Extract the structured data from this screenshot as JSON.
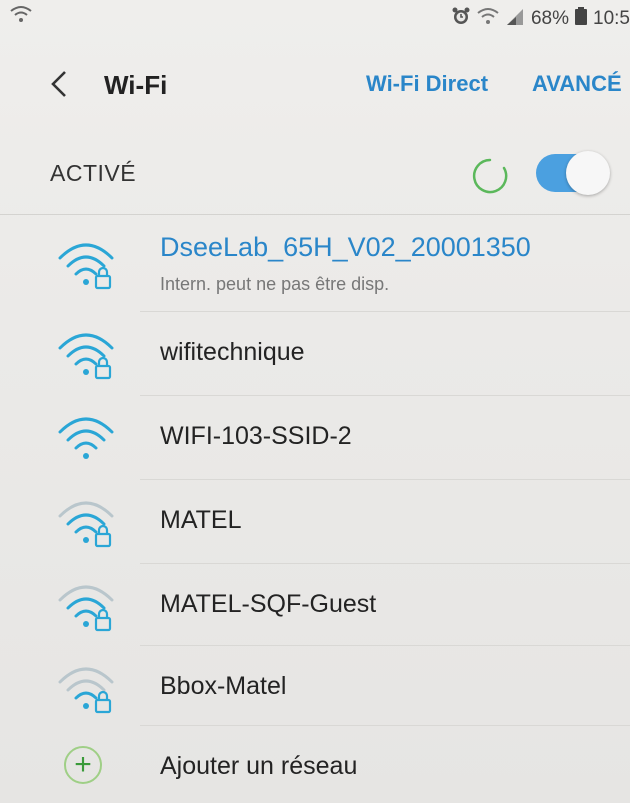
{
  "status_bar": {
    "battery": "68%",
    "time": "10:5",
    "icons": [
      "wifi-icon",
      "alarm-icon",
      "signal-icon",
      "battery-icon"
    ]
  },
  "header": {
    "back_icon": "chevron-left-icon",
    "title": "Wi-Fi",
    "wifi_direct": "Wi-Fi Direct",
    "advanced": "AVANCÉ"
  },
  "toggle_row": {
    "label": "ACTIVÉ",
    "enabled": true
  },
  "networks": [
    {
      "name": "DseeLab_65H_V02_20001350",
      "status": "Intern. peut ne pas être disp.",
      "secured": true,
      "connected": true,
      "signal": 1.0
    },
    {
      "name": "wifitechnique",
      "secured": true,
      "connected": false,
      "signal": 1.0
    },
    {
      "name": "WIFI-103-SSID-2",
      "secured": false,
      "connected": false,
      "signal": 1.0
    },
    {
      "name": "MATEL",
      "secured": true,
      "connected": false,
      "signal": 0.66
    },
    {
      "name": "MATEL-SQF-Guest",
      "secured": true,
      "connected": false,
      "signal": 0.66
    },
    {
      "name": "Bbox-Matel",
      "secured": true,
      "connected": false,
      "signal": 0.33
    }
  ],
  "add_network": {
    "label": "Ajouter un réseau",
    "icon": "plus-icon"
  },
  "colors": {
    "accent": "#2a86c9",
    "wifi_strong": "#2aa6d6",
    "wifi_weak": "#b9c6cc",
    "add_green": "#3a9a3a"
  }
}
